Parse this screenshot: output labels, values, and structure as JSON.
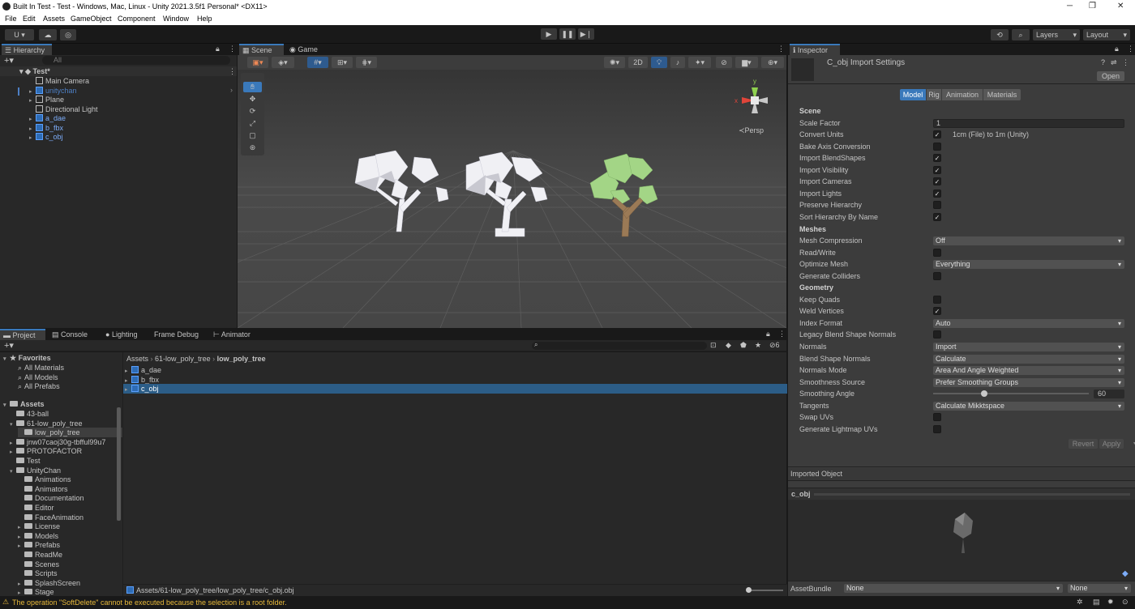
{
  "window": {
    "title": "Built In Test - Test - Windows, Mac, Linux - Unity 2021.3.5f1 Personal* <DX11>"
  },
  "menu": [
    "File",
    "Edit",
    "Assets",
    "GameObject",
    "Component",
    "Window",
    "Help"
  ],
  "toolbar": {
    "account": "U ▾",
    "layers": "Layers",
    "layout": "Layout"
  },
  "hierarchy": {
    "tab": "Hierarchy",
    "search_placeholder": "All",
    "scene": "Test*",
    "items": [
      {
        "label": "Main Camera",
        "color": "#c4c4c4"
      },
      {
        "label": "unitychan",
        "color": "#4d7fc4"
      },
      {
        "label": "Plane",
        "color": "#c4c4c4"
      },
      {
        "label": "Directional Light",
        "color": "#c4c4c4"
      },
      {
        "label": "a_dae",
        "color": "#7cacf8"
      },
      {
        "label": "b_fbx",
        "color": "#7cacf8"
      },
      {
        "label": "c_obj",
        "color": "#7cacf8"
      }
    ]
  },
  "scene_view": {
    "tabs": [
      "Scene",
      "Game"
    ],
    "mode_2d": "2D",
    "persp": "≺Persp",
    "gizmo": {
      "y": "y",
      "x": "x"
    }
  },
  "bottom_tabs": [
    "Project",
    "Console",
    "Lighting",
    "Frame Debug",
    "Animator"
  ],
  "project": {
    "favorites_label": "Favorites",
    "favorites": [
      "All Materials",
      "All Models",
      "All Prefabs"
    ],
    "assets_label": "Assets",
    "tree": [
      {
        "label": "43-ball",
        "depth": 1
      },
      {
        "label": "61-low_poly_tree",
        "depth": 1
      },
      {
        "label": "low_poly_tree",
        "depth": 2
      },
      {
        "label": "jnw07caoj30g-tbfful99u7",
        "depth": 1
      },
      {
        "label": "PROTOFACTOR",
        "depth": 1
      },
      {
        "label": "Test",
        "depth": 1
      },
      {
        "label": "UnityChan",
        "depth": 1
      },
      {
        "label": "Animations",
        "depth": 2
      },
      {
        "label": "Animators",
        "depth": 2
      },
      {
        "label": "Documentation",
        "depth": 2
      },
      {
        "label": "Editor",
        "depth": 2
      },
      {
        "label": "FaceAnimation",
        "depth": 2
      },
      {
        "label": "License",
        "depth": 2
      },
      {
        "label": "Models",
        "depth": 2
      },
      {
        "label": "Prefabs",
        "depth": 2
      },
      {
        "label": "ReadMe",
        "depth": 2
      },
      {
        "label": "Scenes",
        "depth": 2
      },
      {
        "label": "Scripts",
        "depth": 2
      },
      {
        "label": "SplashScreen",
        "depth": 2
      },
      {
        "label": "Stage",
        "depth": 2
      }
    ],
    "breadcrumb": [
      "Assets",
      "61-low_poly_tree",
      "low_poly_tree"
    ],
    "files": [
      "a_dae",
      "b_fbx",
      "c_obj"
    ],
    "selected_file": "c_obj",
    "status_path": "Assets/61-low_poly_tree/low_poly_tree/c_obj.obj",
    "hidden_count": "6"
  },
  "inspector": {
    "tab": "Inspector",
    "title": "C_obj Import Settings",
    "open_button": "Open",
    "tabs": [
      "Model",
      "Rig",
      "Animation",
      "Materials"
    ],
    "rows": [
      {
        "type": "section",
        "label": "Scene"
      },
      {
        "type": "text",
        "label": "Scale Factor",
        "value": "1"
      },
      {
        "type": "check",
        "label": "Convert Units",
        "checked": true,
        "note": "1cm (File) to 1m (Unity)"
      },
      {
        "type": "check",
        "label": "Bake Axis Conversion",
        "checked": false
      },
      {
        "type": "check",
        "label": "Import BlendShapes",
        "checked": true
      },
      {
        "type": "check",
        "label": "Import Visibility",
        "checked": true
      },
      {
        "type": "check",
        "label": "Import Cameras",
        "checked": true
      },
      {
        "type": "check",
        "label": "Import Lights",
        "checked": true
      },
      {
        "type": "check",
        "label": "Preserve Hierarchy",
        "checked": false
      },
      {
        "type": "check",
        "label": "Sort Hierarchy By Name",
        "checked": true
      },
      {
        "type": "section",
        "label": "Meshes"
      },
      {
        "type": "dropdown",
        "label": "Mesh Compression",
        "value": "Off"
      },
      {
        "type": "check",
        "label": "Read/Write",
        "checked": false
      },
      {
        "type": "dropdown",
        "label": "Optimize Mesh",
        "value": "Everything"
      },
      {
        "type": "check",
        "label": "Generate Colliders",
        "checked": false
      },
      {
        "type": "section",
        "label": "Geometry"
      },
      {
        "type": "check",
        "label": "Keep Quads",
        "checked": false
      },
      {
        "type": "check",
        "label": "Weld Vertices",
        "checked": true
      },
      {
        "type": "dropdown",
        "label": "Index Format",
        "value": "Auto"
      },
      {
        "type": "check",
        "label": "Legacy Blend Shape Normals",
        "checked": false
      },
      {
        "type": "dropdown",
        "label": "Normals",
        "value": "Import"
      },
      {
        "type": "dropdown",
        "label": "Blend Shape Normals",
        "value": "Calculate"
      },
      {
        "type": "dropdown",
        "label": "Normals Mode",
        "value": "Area And Angle Weighted"
      },
      {
        "type": "dropdown",
        "label": "Smoothness Source",
        "value": "Prefer Smoothing Groups"
      },
      {
        "type": "slider",
        "label": "Smoothing Angle",
        "value": "60",
        "fraction": 0.33
      },
      {
        "type": "dropdown",
        "label": "Tangents",
        "value": "Calculate Mikktspace"
      },
      {
        "type": "check",
        "label": "Swap UVs",
        "checked": false
      },
      {
        "type": "check",
        "label": "Generate Lightmap UVs",
        "checked": false
      }
    ],
    "revert": "Revert",
    "apply": "Apply",
    "imported_object": "Imported Object",
    "preview_name": "c_obj",
    "assetbundle_label": "AssetBundle",
    "assetbundle_value": "None",
    "assetbundle_variant": "None"
  },
  "status_bar": {
    "message": "The operation \"SoftDelete\" cannot be executed because the selection is a root folder."
  }
}
